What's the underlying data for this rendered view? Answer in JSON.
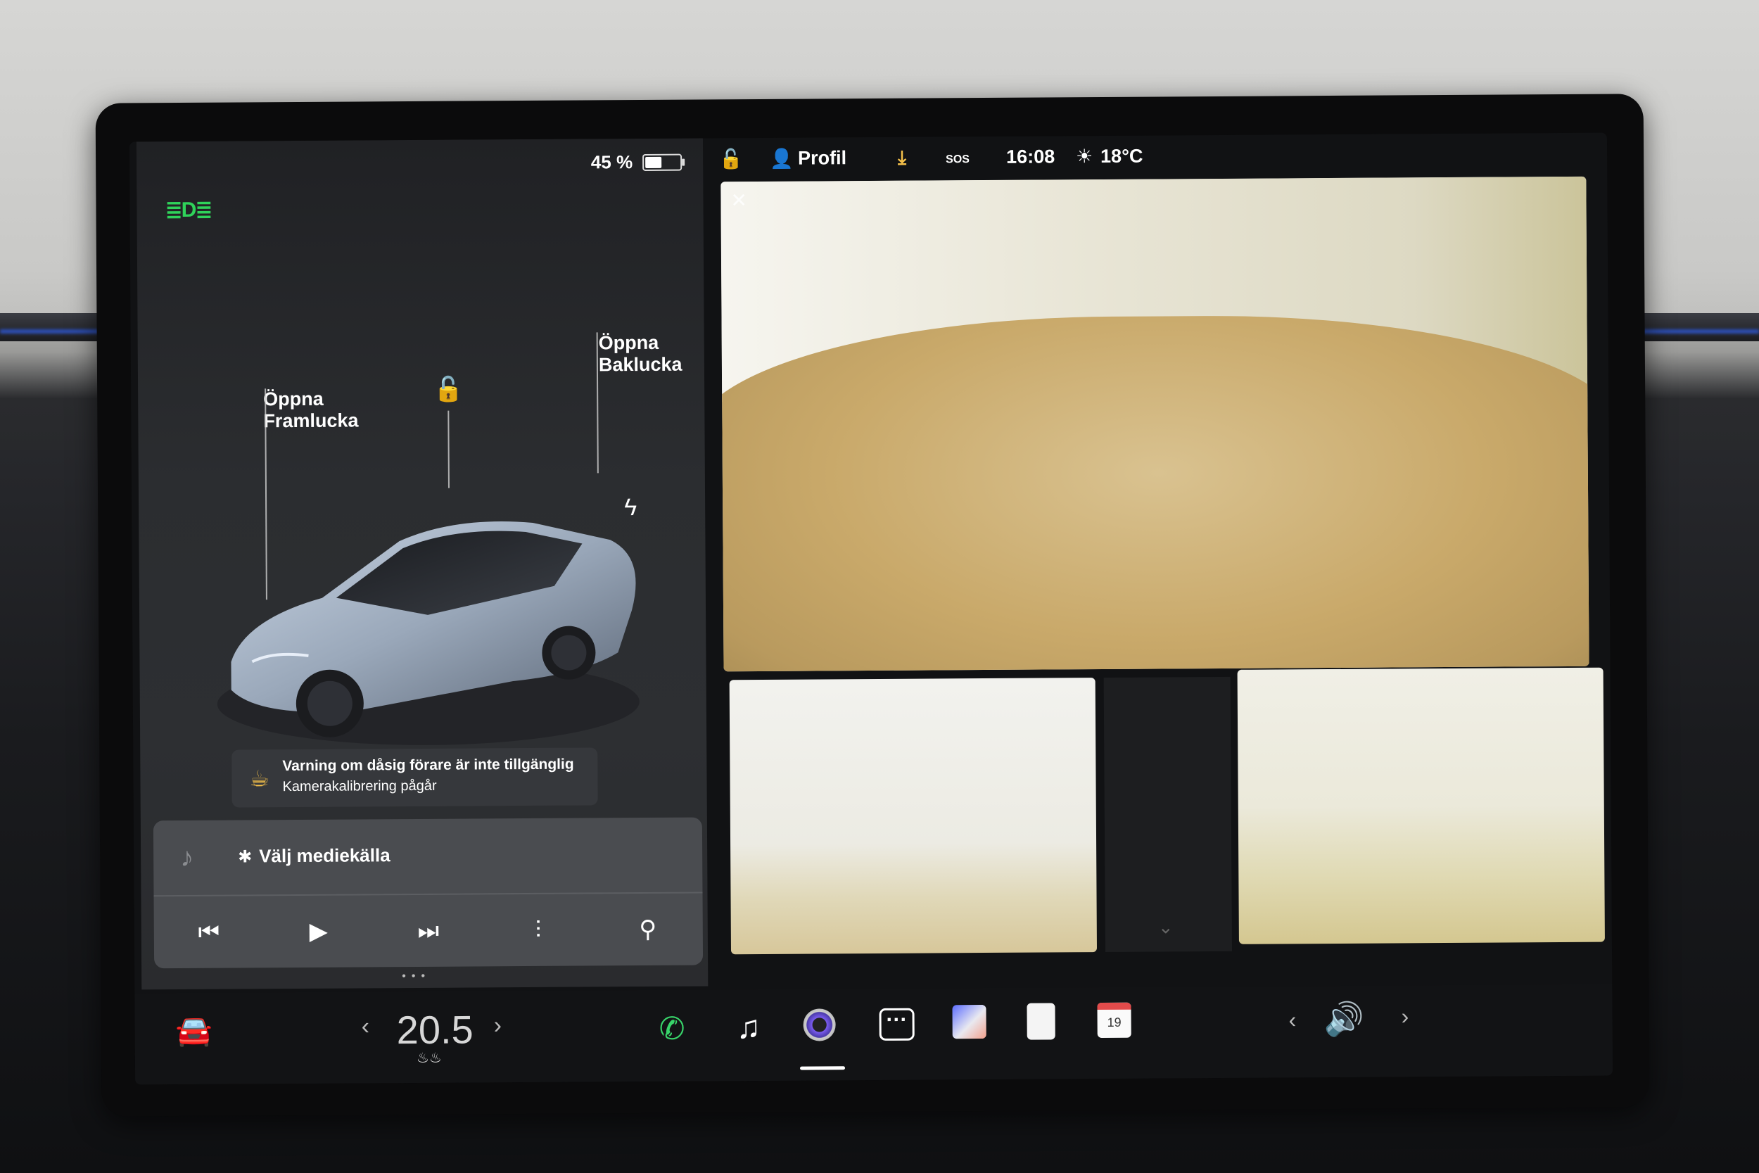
{
  "status": {
    "battery_percent": "45 %",
    "battery_level": 0.45,
    "profile": "Profil",
    "sos": "SOS",
    "time": "16:08",
    "temperature_outside": "18°C"
  },
  "vehicle": {
    "frunk_line1": "Öppna",
    "frunk_line2": "Framlucka",
    "trunk_line1": "Öppna",
    "trunk_line2": "Baklucka"
  },
  "warning": {
    "title": "Varning om dåsig förare är inte tillgänglig",
    "subtitle": "Kamerakalibrering pågår"
  },
  "media": {
    "source_label": "Välj mediekälla"
  },
  "climate": {
    "temperature": "20.5"
  },
  "calendar": {
    "day": "19"
  },
  "icons": {
    "headlight": "headlight-icon",
    "lock": "unlock-icon",
    "charge": "bolt-icon",
    "phone": "phone-icon",
    "music": "music-icon",
    "camera": "camera-icon",
    "more": "more-icon",
    "navigation": "navigation-icon",
    "notes": "notes-icon",
    "calendar": "calendar-icon",
    "volume": "volume-icon"
  },
  "colors": {
    "headlight_green": "#2fd35a",
    "phone_green": "#38d46a",
    "accent_purple": "#7b5cf0"
  }
}
